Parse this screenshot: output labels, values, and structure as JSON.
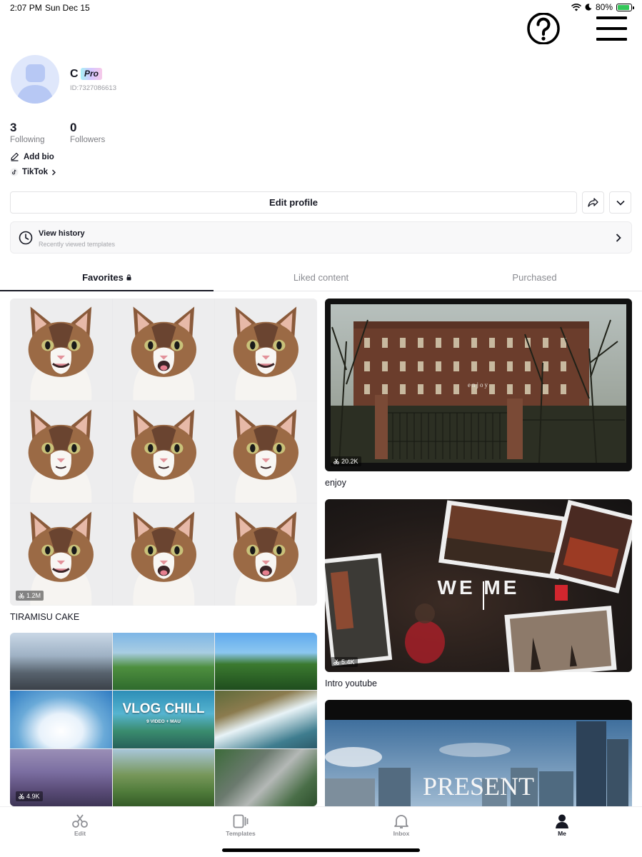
{
  "status_bar": {
    "time": "2:07 PM",
    "date": "Sun Dec 15",
    "battery_text": "80%",
    "battery_level": 0.8
  },
  "header": {
    "help_icon": "question-circle-icon",
    "menu_icon": "hamburger-menu-icon"
  },
  "profile": {
    "name": "C",
    "badge": "Pro",
    "user_id": "ID:7327086613",
    "following_count": "3",
    "following_label": "Following",
    "followers_count": "0",
    "followers_label": "Followers",
    "add_bio": "Add bio",
    "linked_app": "TikTok",
    "edit_profile": "Edit profile"
  },
  "history": {
    "title": "View history",
    "subtitle": "Recently viewed templates"
  },
  "tabs": [
    {
      "label": "Favorites"
    },
    {
      "label": "Liked content"
    },
    {
      "label": "Purchased"
    }
  ],
  "templates": [
    {
      "title": "TIRAMISU CAKE",
      "uses": "1.2M"
    },
    {
      "title": "",
      "uses": "4.9K",
      "overlay_text": "VLOG CHILL",
      "overlay_sub": "9 VIDEO + MAU"
    },
    {
      "title": "enjoy",
      "uses": "20.2K",
      "overlay_text": "enjoy"
    },
    {
      "title": "Intro youtube",
      "uses": "5.4K",
      "overlay_text": "WE  ME"
    },
    {
      "title": "",
      "uses": "",
      "overlay_text": "PRESENT"
    }
  ],
  "bottom_nav": [
    {
      "label": "Edit",
      "icon": "scissors-icon"
    },
    {
      "label": "Templates",
      "icon": "templates-icon"
    },
    {
      "label": "Inbox",
      "icon": "bell-icon"
    },
    {
      "label": "Me",
      "icon": "person-icon"
    }
  ],
  "colors": {
    "text": "#161823",
    "muted": "#8a8b91",
    "wifi_charge": "#34c759"
  }
}
